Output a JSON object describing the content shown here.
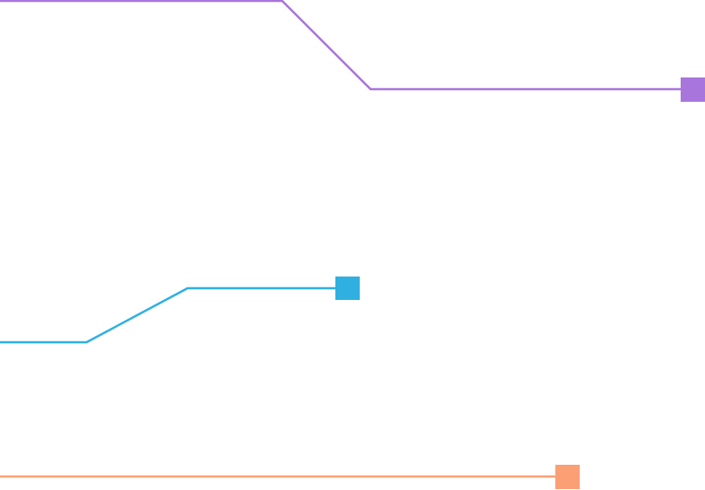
{
  "connectors": [
    {
      "id": "purple",
      "color": "#a875dc",
      "endpoint_shape": "square"
    },
    {
      "id": "blue",
      "color": "#2fb0e0",
      "endpoint_shape": "square"
    },
    {
      "id": "orange",
      "color": "#fba074",
      "endpoint_shape": "square"
    }
  ]
}
